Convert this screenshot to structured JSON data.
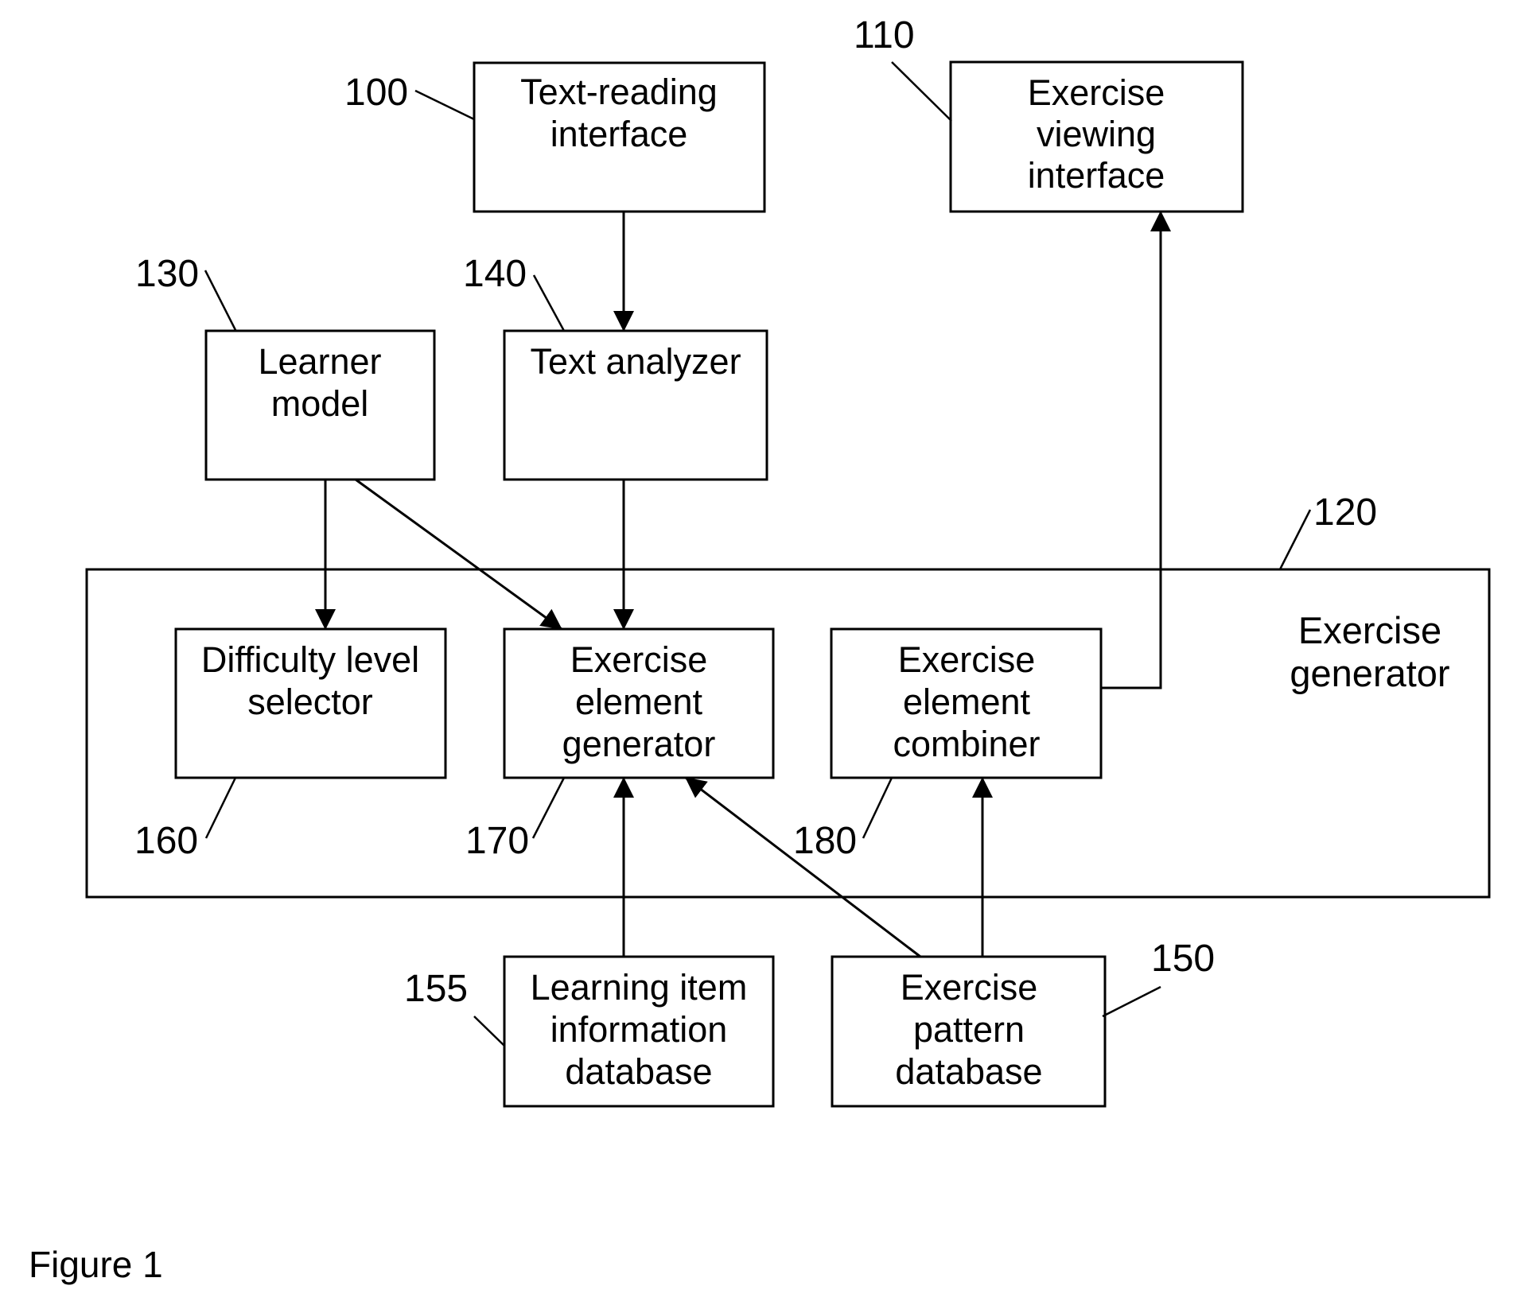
{
  "figure": {
    "caption": "Figure 1",
    "colors": {
      "stroke": "#000000",
      "background": "#ffffff"
    }
  },
  "group": {
    "id": "exercise-generator",
    "ref": "120",
    "lines": [
      "Exercise",
      "generator"
    ]
  },
  "blocks": [
    {
      "id": "text-reading-interface",
      "ref": "100",
      "lines": [
        "Text-reading",
        "interface"
      ]
    },
    {
      "id": "exercise-viewing-interface",
      "ref": "110",
      "lines": [
        "Exercise",
        "viewing",
        "interface"
      ]
    },
    {
      "id": "learner-model",
      "ref": "130",
      "lines": [
        "Learner",
        "model"
      ]
    },
    {
      "id": "text-analyzer",
      "ref": "140",
      "lines": [
        "Text analyzer"
      ]
    },
    {
      "id": "difficulty-level-selector",
      "ref": "160",
      "lines": [
        "Difficulty level",
        "selector"
      ]
    },
    {
      "id": "exercise-element-generator",
      "ref": "170",
      "lines": [
        "Exercise",
        "element",
        "generator"
      ]
    },
    {
      "id": "exercise-element-combiner",
      "ref": "180",
      "lines": [
        "Exercise",
        "element",
        "combiner"
      ]
    },
    {
      "id": "learning-item-information-database",
      "ref": "155",
      "lines": [
        "Learning item",
        "information",
        "database"
      ]
    },
    {
      "id": "exercise-pattern-database",
      "ref": "150",
      "lines": [
        "Exercise",
        "pattern",
        "database"
      ]
    }
  ],
  "connections": [
    {
      "from": "text-reading-interface",
      "to": "text-analyzer"
    },
    {
      "from": "learner-model",
      "to": "difficulty-level-selector"
    },
    {
      "from": "learner-model",
      "to": "exercise-element-generator"
    },
    {
      "from": "text-analyzer",
      "to": "exercise-element-generator"
    },
    {
      "from": "exercise-element-combiner",
      "to": "exercise-viewing-interface"
    },
    {
      "from": "learning-item-information-database",
      "to": "exercise-element-generator"
    },
    {
      "from": "exercise-pattern-database",
      "to": "exercise-element-generator"
    },
    {
      "from": "exercise-pattern-database",
      "to": "exercise-element-combiner"
    }
  ]
}
